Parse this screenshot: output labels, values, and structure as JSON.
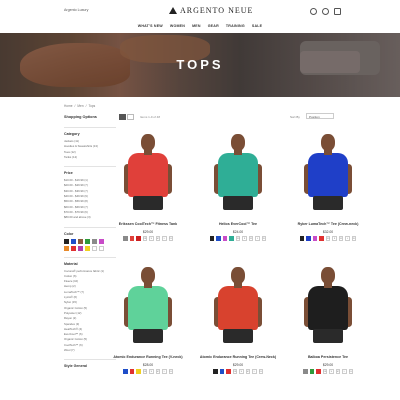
{
  "header": {
    "locale": "Argento Luxury",
    "brand": "ARGENTO NEUE",
    "nav": [
      "WHAT'S NEW",
      "WOMEN",
      "MEN",
      "GEAR",
      "TRAINING",
      "SALE"
    ]
  },
  "hero": {
    "title": "TOPS"
  },
  "breadcrumb": [
    "Home",
    "/",
    "Men",
    "/",
    "Tops"
  ],
  "toolbar": {
    "count": "Items 1-9 of 48",
    "sort_label": "Sort By",
    "sort_value": "Position"
  },
  "sidebar": {
    "title": "Shopping Options",
    "category": {
      "label": "Category",
      "items": [
        "Jackets (11)",
        "Hoodies & Sweatshirts (13)",
        "Tees (12)",
        "Tanks (12)"
      ]
    },
    "price": {
      "label": "Price",
      "items": [
        "$10.00 - $19.99 (1)",
        "$20.00 - $29.99 (7)",
        "$30.00 - $39.99 (7)",
        "$40.00 - $49.99 (9)",
        "$50.00 - $59.99 (8)",
        "$60.00 - $69.99 (7)",
        "$70.00 - $79.99 (6)",
        "$80.00 and above (3)"
      ]
    },
    "color": {
      "label": "Color",
      "swatches": [
        "#222222",
        "#1e4ec8",
        "#8a5a3a",
        "#2e9a3a",
        "#8a8a8a",
        "#c84cc8",
        "#e88a2a",
        "#e03030",
        "#b040b0",
        "#f0d020",
        "#ffffff",
        "#ffffff"
      ]
    },
    "material": {
      "label": "Material",
      "items": [
        "Cocona® performance fabric (1)",
        "Cotton (6)",
        "Fleece (10)",
        "Hemp (2)",
        "LumaTech™ (7)",
        "Lycra® (6)",
        "Nylon (15)",
        "Organic Cotton (5)",
        "Polyester (12)",
        "Rayon (2)",
        "Spandex (3)",
        "HeatTech® (4)",
        "EverCool™ (6)",
        "Organic Cotton (5)",
        "CoolTech™ (6)",
        "Wool (7)"
      ]
    },
    "style": {
      "label": "Style General"
    }
  },
  "products": [
    {
      "name": "Erikssen CoolTech™ Fitness Tank",
      "price": "$29.00",
      "shirt": "#e0403a",
      "colors": [
        "#8a8a8a",
        "#e0403a",
        "#cc2020"
      ],
      "sizes": [
        "XS",
        "S",
        "M",
        "L",
        "XL"
      ]
    },
    {
      "name": "Helios EverCool™ Tee",
      "price": "$24.00",
      "shirt": "#2fae96",
      "colors": [
        "#222222",
        "#1e4ec8",
        "#c84cc8",
        "#2fae96"
      ],
      "sizes": [
        "XS",
        "S",
        "M",
        "L",
        "XL"
      ]
    },
    {
      "name": "Ryker LumaTech™ Tee (Crew-neck)",
      "price": "$32.00",
      "shirt": "#1f3fc8",
      "colors": [
        "#222222",
        "#1f3fc8",
        "#c84cc8",
        "#e03030"
      ],
      "sizes": [
        "XS",
        "S",
        "M",
        "L",
        "XL"
      ]
    },
    {
      "name": "Atomic Endurance Running Tee (V-neck)",
      "price": "$28.00",
      "shirt": "#5fd29a",
      "colors": [
        "#1e4ec8",
        "#e03030",
        "#f0d020"
      ],
      "sizes": [
        "XS",
        "S",
        "M",
        "L",
        "XL"
      ]
    },
    {
      "name": "Atomic Endurance Running Tee (Crew-Neck)",
      "price": "$29.00",
      "shirt": "#d8422e",
      "colors": [
        "#222222",
        "#1e4ec8",
        "#e03030"
      ],
      "sizes": [
        "XS",
        "S",
        "M",
        "L",
        "XL"
      ]
    },
    {
      "name": "Balboa Persistence Tee",
      "price": "$29.00",
      "shirt": "#1e1e1e",
      "colors": [
        "#8a8a8a",
        "#2e9a3a",
        "#e03030"
      ],
      "sizes": [
        "XS",
        "S",
        "M",
        "L",
        "XL"
      ]
    }
  ]
}
